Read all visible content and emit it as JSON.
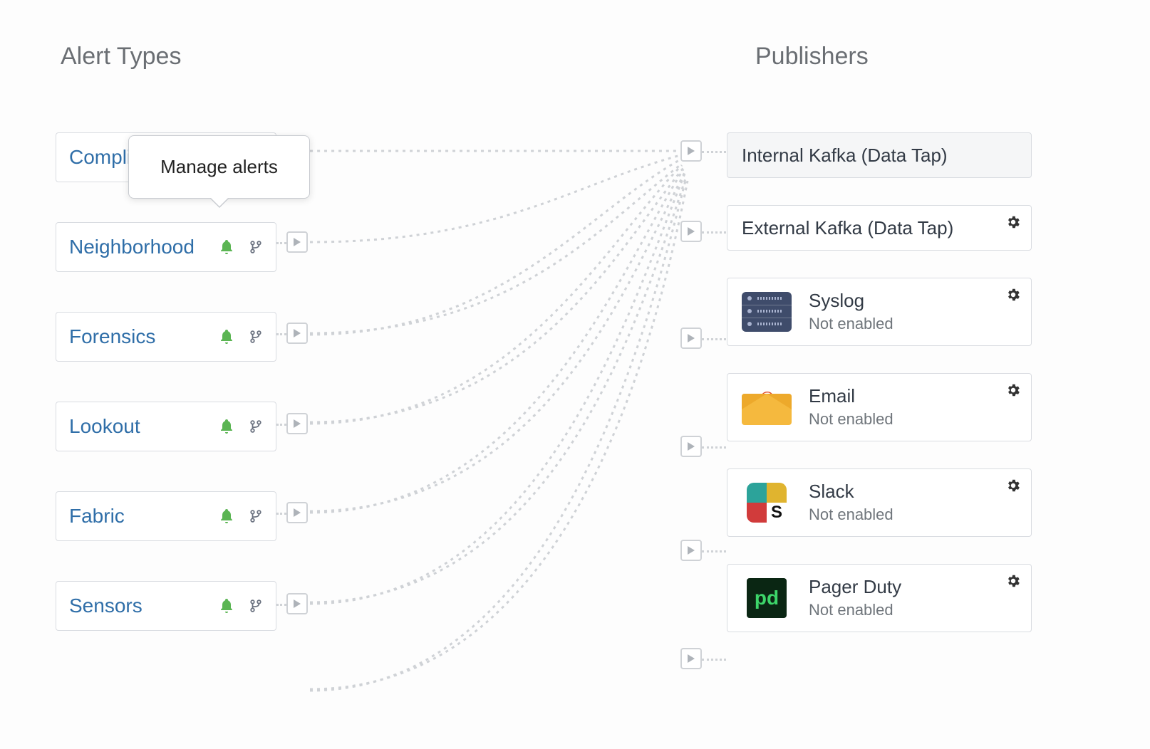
{
  "headings": {
    "alert_types": "Alert Types",
    "publishers": "Publishers"
  },
  "tooltip": {
    "text": "Manage alerts"
  },
  "alerts": [
    {
      "label": "Compliance"
    },
    {
      "label": "Neighborhood"
    },
    {
      "label": "Forensics"
    },
    {
      "label": "Lookout"
    },
    {
      "label": "Fabric"
    },
    {
      "label": "Sensors"
    }
  ],
  "publishers": [
    {
      "title": "Internal Kafka (Data Tap)",
      "status": null,
      "has_gear": false,
      "icon": null,
      "disabled_bg": true
    },
    {
      "title": "External Kafka (Data Tap)",
      "status": null,
      "has_gear": true,
      "icon": null,
      "disabled_bg": false
    },
    {
      "title": "Syslog",
      "status": "Not enabled",
      "has_gear": true,
      "icon": "syslog",
      "disabled_bg": false
    },
    {
      "title": "Email",
      "status": "Not enabled",
      "has_gear": true,
      "icon": "email",
      "disabled_bg": false
    },
    {
      "title": "Slack",
      "status": "Not enabled",
      "has_gear": true,
      "icon": "slack",
      "disabled_bg": false
    },
    {
      "title": "Pager Duty",
      "status": "Not enabled",
      "has_gear": true,
      "icon": "pagerduty",
      "disabled_bg": false
    }
  ],
  "colors": {
    "link": "#2f6ea8",
    "bell": "#5bb553",
    "border": "#d9dce1",
    "muted": "#cfd2d6"
  }
}
